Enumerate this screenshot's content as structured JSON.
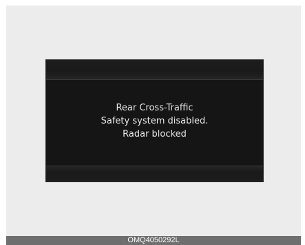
{
  "display": {
    "lines": [
      "Rear Cross-Traffic",
      "Safety system disabled.",
      "Radar blocked"
    ]
  },
  "footer": {
    "code": "OMQ4050292L"
  },
  "colors": {
    "background": "#ececec",
    "display": "#151515",
    "text": "#e6e6e6",
    "footer_bar": "#6e6e6e"
  }
}
